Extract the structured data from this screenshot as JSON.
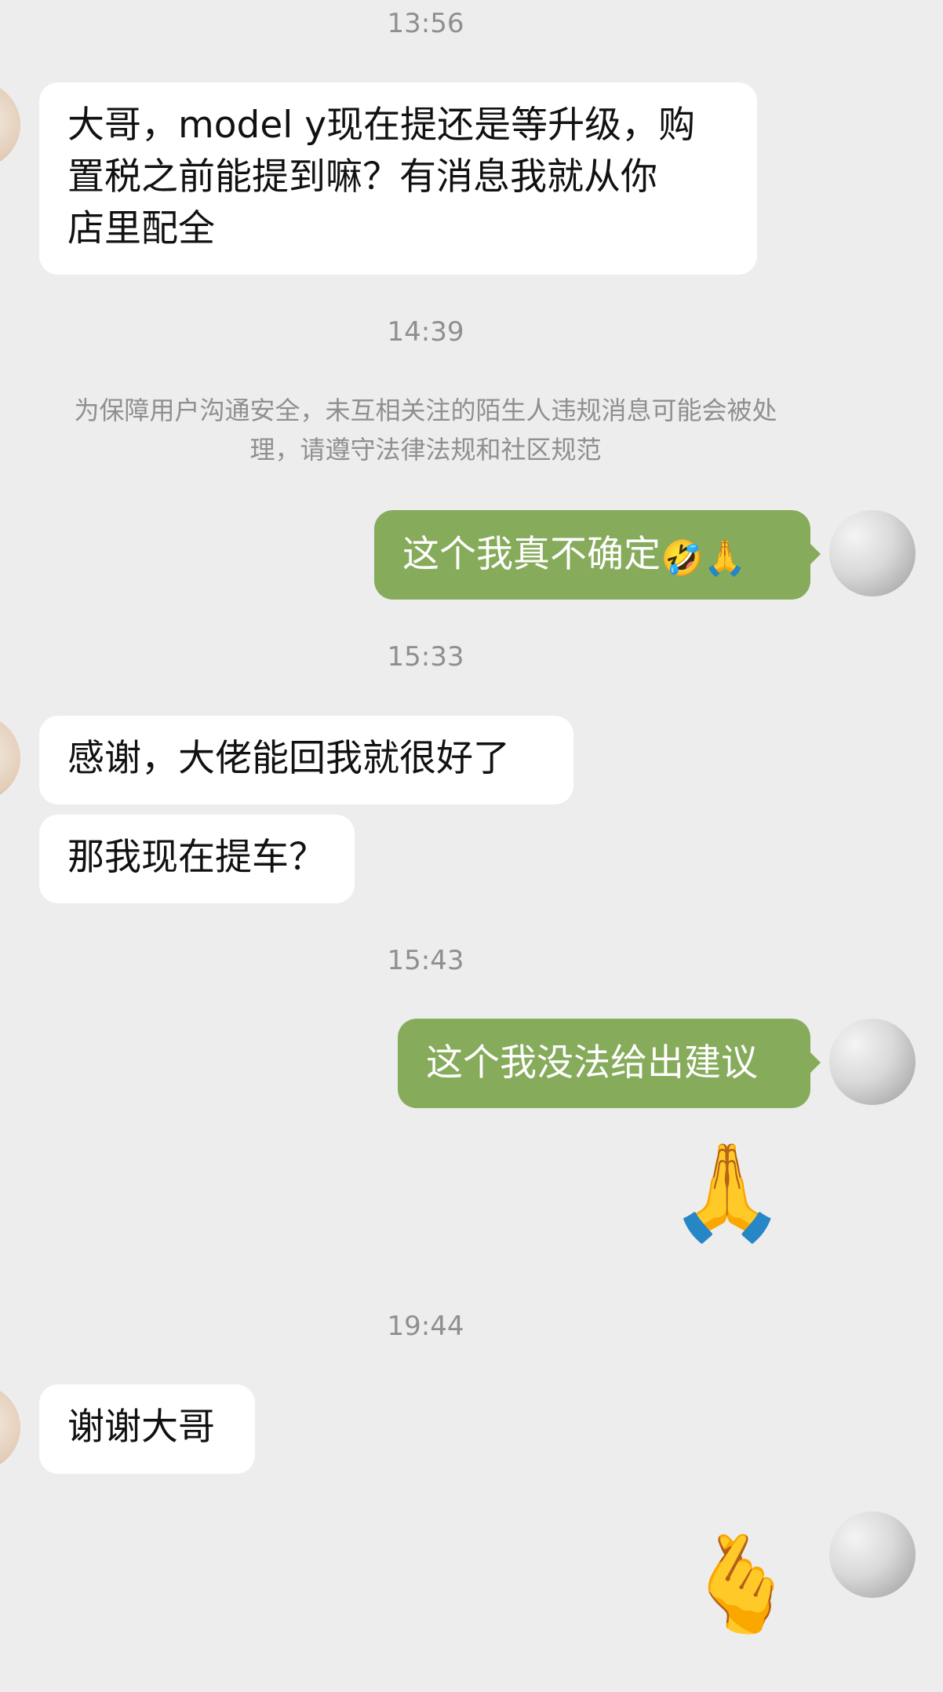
{
  "colors": {
    "background": "#ededed",
    "incoming_bubble": "#ffffff",
    "outgoing_bubble": "#86ab5b",
    "timestamp_text": "#8f8f8f"
  },
  "messages": {
    "t1": "13:56",
    "m1_line1": "大哥，model y现在提还是等升级，购",
    "m1_line2": "置税之前能提到嘛？有消息我就从你",
    "m1_line3": "店里配全",
    "t2": "14:39",
    "notice_line1": "为保障用户沟通安全，未互相关注的陌生人违规消息可能会被处",
    "notice_line2": "理，请遵守法律法规和社区规范",
    "m2_text": "这个我真不确定",
    "m2_emoji1": "🤣",
    "m2_emoji2": "🙏",
    "t3": "15:33",
    "m3": "感谢，大佬能回我就很好了",
    "m4": "那我现在提车？",
    "t4": "15:43",
    "m5": "这个我没法给出建议",
    "sticker1": "🙏",
    "t5": "19:44",
    "m6": "谢谢大哥",
    "sticker2": "🫰"
  }
}
